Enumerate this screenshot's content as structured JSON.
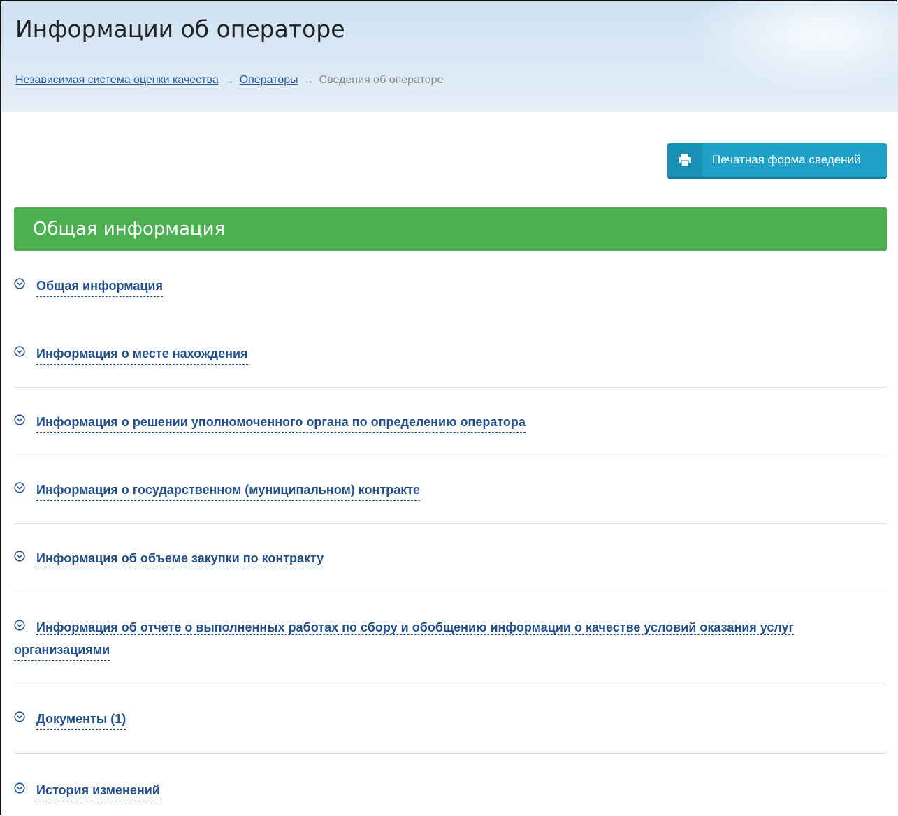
{
  "header": {
    "title": "Информации об операторе",
    "breadcrumb": [
      {
        "label": "Независимая система оценки качества",
        "link": true
      },
      {
        "label": "Операторы",
        "link": true
      },
      {
        "label": "Сведения об операторе",
        "link": false
      }
    ],
    "separator": "→"
  },
  "print_button": {
    "label": "Печатная форма сведений",
    "icon": "printer-icon"
  },
  "section": {
    "title": "Общая информация"
  },
  "accordion": {
    "items": [
      {
        "label": "Общая информация"
      },
      {
        "label": "Информация о месте нахождения"
      },
      {
        "label": "Информация о решении уполномоченного органа по определению оператора"
      },
      {
        "label": "Информация о государственном (муниципальном) контракте"
      },
      {
        "label": "Информация об объеме закупки по контракту"
      },
      {
        "label_line1": "Информация об отчете о выполненных работах по сбору и обобщению информации о качестве условий оказания услуг",
        "label_line2": "организациями"
      },
      {
        "label": "Документы (1)"
      },
      {
        "label": "История изменений"
      }
    ],
    "icon": "chevron-down-circle-icon"
  },
  "colors": {
    "accent_green": "#4caf50",
    "button_blue": "#1fa0c9",
    "link_blue": "#23508a"
  }
}
